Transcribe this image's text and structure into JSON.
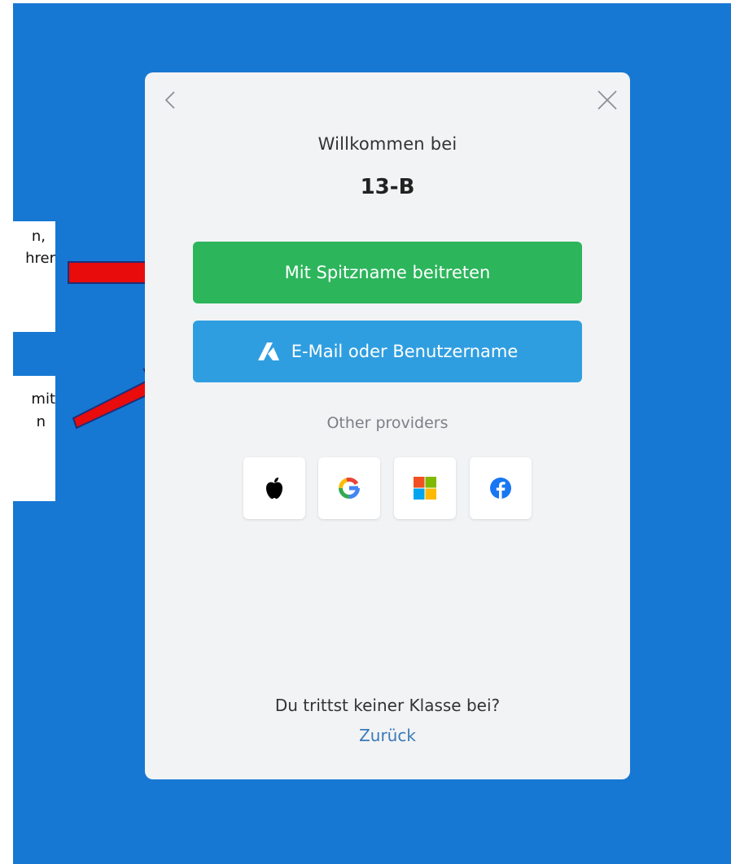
{
  "notes": [
    {
      "line1": "n,",
      "line2": "hrer"
    },
    {
      "line1": "mit",
      "line2": "n"
    }
  ],
  "card": {
    "welcome": "Willkommen bei",
    "class_name": "13-B",
    "nickname_button": "Mit Spitzname beitreten",
    "email_button": "E-Mail oder Benutzername",
    "providers_label": "Other providers",
    "providers": [
      "apple-icon",
      "google-icon",
      "microsoft-icon",
      "facebook-icon"
    ],
    "footer_question": "Du trittst keiner Klasse bei?",
    "footer_link": "Zurück"
  },
  "colors": {
    "background": "#1778d3",
    "card": "#f2f3f5",
    "green_button": "#2cb55b",
    "blue_button": "#2f9ee0",
    "arrow": "#e80c0c"
  }
}
